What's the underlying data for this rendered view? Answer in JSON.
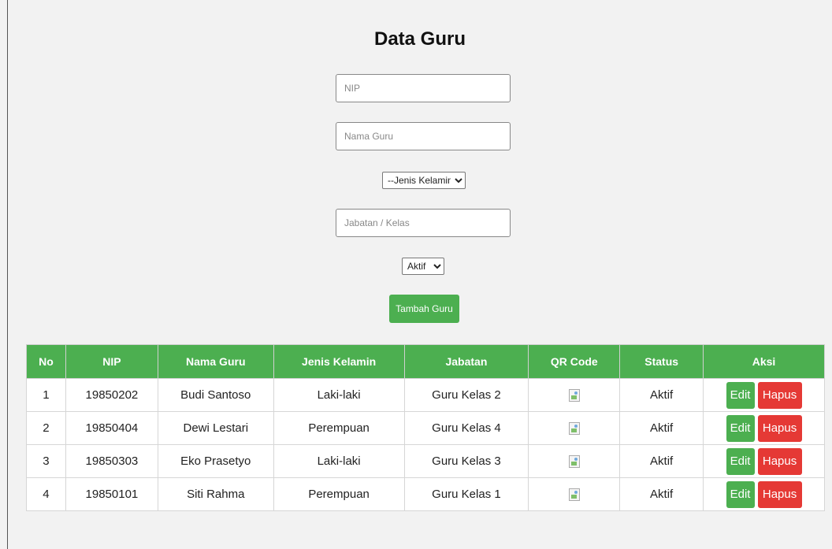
{
  "page_title": "Data Guru",
  "form": {
    "nip_placeholder": "NIP",
    "nama_placeholder": "Nama Guru",
    "gender_selected": "--Jenis Kelamin--",
    "jabatan_placeholder": "Jabatan / Kelas",
    "status_selected": "Aktif",
    "submit_label": "Tambah Guru"
  },
  "table": {
    "headers": [
      "No",
      "NIP",
      "Nama Guru",
      "Jenis Kelamin",
      "Jabatan",
      "QR Code",
      "Status",
      "Aksi"
    ],
    "rows": [
      {
        "no": "1",
        "nip": "19850202",
        "nama": "Budi Santoso",
        "jk": "Laki-laki",
        "jabatan": "Guru Kelas 2",
        "status": "Aktif"
      },
      {
        "no": "2",
        "nip": "19850404",
        "nama": "Dewi Lestari",
        "jk": "Perempuan",
        "jabatan": "Guru Kelas 4",
        "status": "Aktif"
      },
      {
        "no": "3",
        "nip": "19850303",
        "nama": "Eko Prasetyo",
        "jk": "Laki-laki",
        "jabatan": "Guru Kelas 3",
        "status": "Aktif"
      },
      {
        "no": "4",
        "nip": "19850101",
        "nama": "Siti Rahma",
        "jk": "Perempuan",
        "jabatan": "Guru Kelas 1",
        "status": "Aktif"
      }
    ],
    "edit_label": "Edit",
    "delete_label": "Hapus"
  },
  "icons": {
    "qr": "broken-image-icon",
    "dropdown": "chevron-down-icon"
  },
  "colors": {
    "primary": "#4caf50",
    "danger": "#e53935",
    "background": "#f2f2f2"
  }
}
